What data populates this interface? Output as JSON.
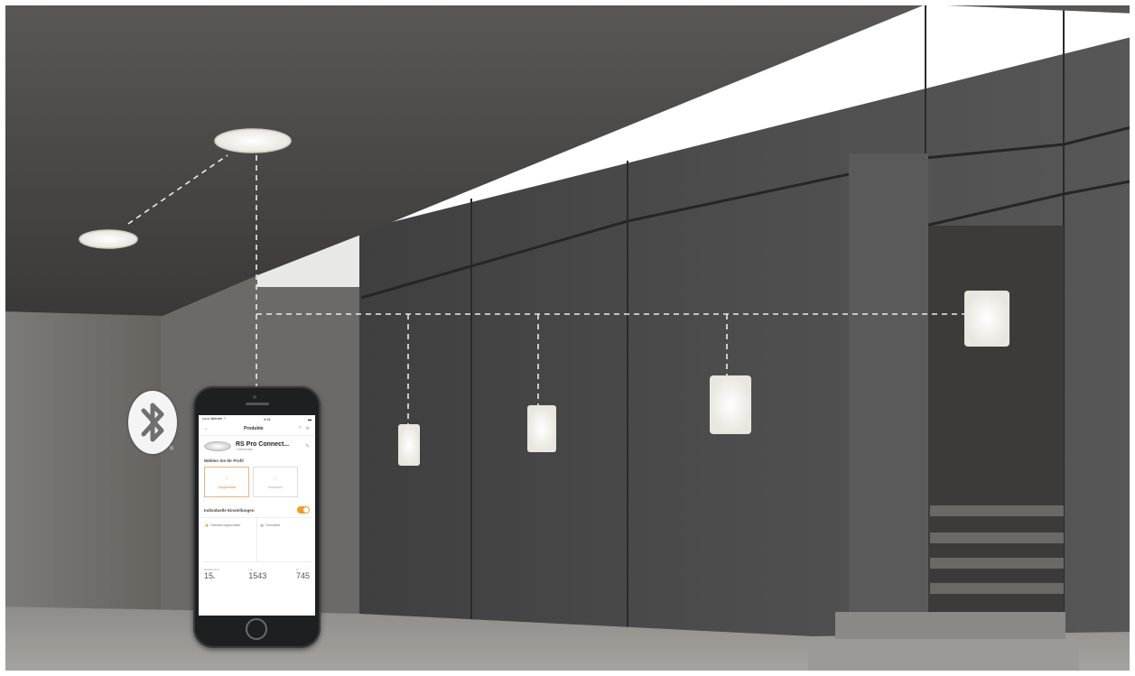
{
  "scene": {
    "description_labels": [],
    "colors": {
      "concrete": "#5b5b5b",
      "ceiling": "#4a4846",
      "floor": "#8a8885",
      "light": "#f7f4ee",
      "dash": "#e8e8e8",
      "accent": "#f59a2a"
    }
  },
  "phone": {
    "status": {
      "carrier": "•••••• Betrieb ⌔",
      "time": "9:41"
    },
    "header": {
      "back": "←",
      "title": "Produkte",
      "icons": [
        "?",
        "⚙"
      ]
    },
    "product": {
      "name": "RS Pro Connect...",
      "subtitle": "• Verbunden",
      "edit_icon": "✎"
    },
    "profile_section": "Wählen Sie Ihr Profil",
    "profiles": [
      {
        "label": "Treppenhaus",
        "icon": "◌",
        "active": true
      },
      {
        "label": "Individuell",
        "icon": "◌",
        "active": false
      }
    ],
    "individual_settings": "Individuelle Einstellungen",
    "modes": [
      {
        "label": "Dämmerungsschalter",
        "icon": "✺"
      },
      {
        "label": "Grundlicht",
        "icon": "✺"
      }
    ],
    "stats": [
      {
        "label": "Nachlaufzeit",
        "value": "15",
        "unit": "s"
      },
      {
        "label": "Lux",
        "value": "1543",
        "unit": ""
      },
      {
        "label": "lm",
        "value": "745",
        "unit": ""
      }
    ]
  },
  "bluetooth": {
    "icon": "bluetooth-icon",
    "mark": "®"
  }
}
